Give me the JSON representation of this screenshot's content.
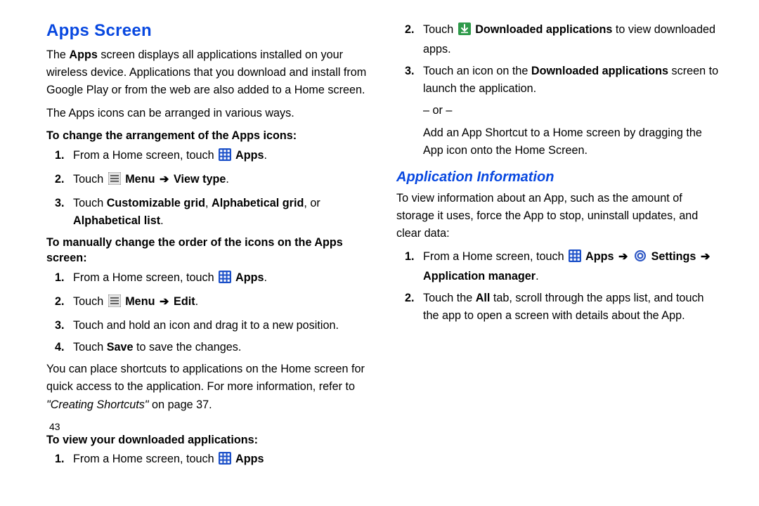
{
  "headings": {
    "apps_screen": "Apps Screen",
    "app_info": "Application Information"
  },
  "intro": {
    "p1a": "The ",
    "p1b": "Apps",
    "p1c": " screen displays all applications installed on your wireless device. Applications that you download and install from Google Play or from the web are also added to a Home screen.",
    "p2": "The Apps icons can be arranged in various ways."
  },
  "section1": {
    "title": "To change the arrangement of the Apps icons:",
    "s1a": "From a Home screen, touch ",
    "s1b": " Apps",
    "s1c": ".",
    "s2a": "Touch ",
    "s2b": " Menu ",
    "s2c": " View type",
    "s2d": ".",
    "s3a": "Touch ",
    "s3b": "Customizable grid",
    "s3c": ", ",
    "s3d": "Alphabetical grid",
    "s3e": ", or ",
    "s3f": "Alphabetical list",
    "s3g": "."
  },
  "section2": {
    "title": "To manually change the order of the icons on the Apps screen:",
    "s1a": "From a Home screen, touch ",
    "s1b": " Apps",
    "s1c": ".",
    "s2a": "Touch ",
    "s2b": " Menu ",
    "s2c": " Edit",
    "s2d": ".",
    "s3": "Touch and hold an icon and drag it to a new position.",
    "s4a": "Touch ",
    "s4b": "Save",
    "s4c": " to save the changes."
  },
  "shortcut_para_a": "You can place shortcuts to applications on the Home screen for quick access to the application. For more information, refer to ",
  "shortcut_para_b": "\"Creating Shortcuts\"",
  "shortcut_para_c": " on page 37.",
  "pagenum": "43",
  "section3": {
    "title": "To view your downloaded applications:",
    "s1a": "From a Home screen, touch ",
    "s1b": " Apps",
    "s2a": "Touch ",
    "s2b": " Downloaded applications",
    "s2c": " to view downloaded apps.",
    "s3a": "Touch an icon on the ",
    "s3b": "Downloaded applications",
    "s3c": " screen to launch the application.",
    "or": "– or –",
    "s3d": "Add an App Shortcut to a Home screen by dragging the App icon onto the Home Screen."
  },
  "appinfo": {
    "p1": "To view information about an App, such as the amount of storage it uses, force the App to stop, uninstall updates, and clear data:",
    "s1a": "From a Home screen, touch ",
    "s1b": " Apps ",
    "s1c": " Settings ",
    "s1d": " Application manager",
    "s1e": ".",
    "s2a": "Touch the ",
    "s2b": "All",
    "s2c": " tab, scroll through the apps list, and touch the app to open a screen with details about the App."
  }
}
